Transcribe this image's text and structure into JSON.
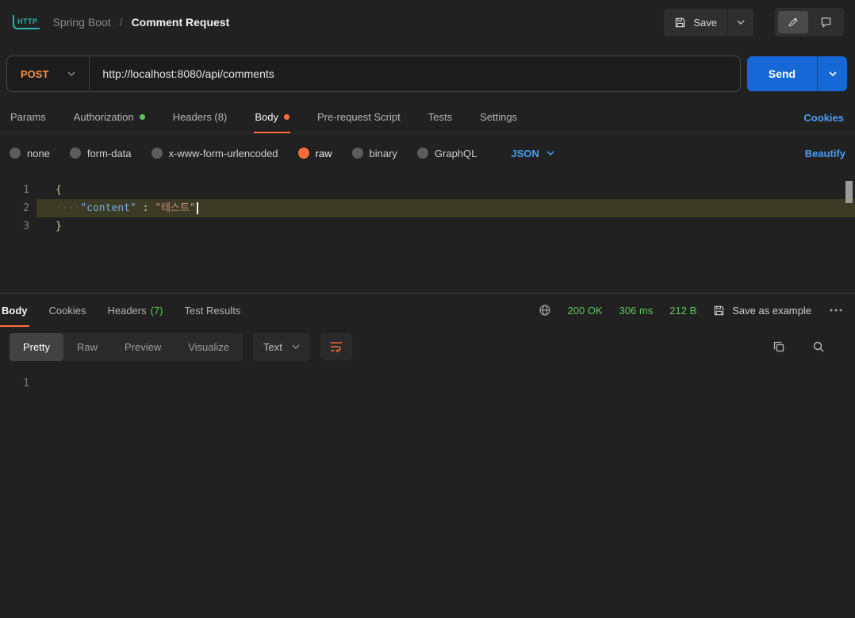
{
  "colors": {
    "background": "#212121",
    "accent_orange": "#ff6c37",
    "link_blue": "#4a9df8",
    "success_green": "#5dc75d",
    "send_button_blue": "#1568d5",
    "method_post_orange": "#ff8e42",
    "logo_teal": "#29b5a8"
  },
  "header": {
    "logo": "HTTP",
    "collection_name": "Spring Boot",
    "separator": "/",
    "request_name": "Comment Request",
    "save_label": "Save"
  },
  "request": {
    "method": "POST",
    "url": "http://localhost:8080/api/comments",
    "send_label": "Send"
  },
  "request_tabs": {
    "params": "Params",
    "authorization": "Authorization",
    "headers": "Headers (8)",
    "body": "Body",
    "pre_request_script": "Pre-request Script",
    "tests": "Tests",
    "settings": "Settings",
    "cookies_link": "Cookies"
  },
  "body_options": {
    "none": "none",
    "form_data": "form-data",
    "x_www_form_urlencoded": "x-www-form-urlencoded",
    "raw": "raw",
    "binary": "binary",
    "graphql": "GraphQL",
    "language": "JSON",
    "beautify_link": "Beautify"
  },
  "editor": {
    "line1": {
      "number": "1",
      "text": "{"
    },
    "line2": {
      "number": "2",
      "indent": "····",
      "key": "\"content\"",
      "separator": " : ",
      "value": "\"테스트\""
    },
    "line3": {
      "number": "3",
      "text": "}"
    }
  },
  "response": {
    "tabs": {
      "body": "Body",
      "cookies": "Cookies",
      "headers": "Headers",
      "headers_count": "(7)",
      "test_results": "Test Results"
    },
    "status": "200 OK",
    "time": "306 ms",
    "size": "212 B",
    "save_as_example": "Save as example",
    "views": {
      "pretty": "Pretty",
      "raw": "Raw",
      "preview": "Preview",
      "visualize": "Visualize"
    },
    "format": "Text",
    "body_line_number": "1"
  }
}
